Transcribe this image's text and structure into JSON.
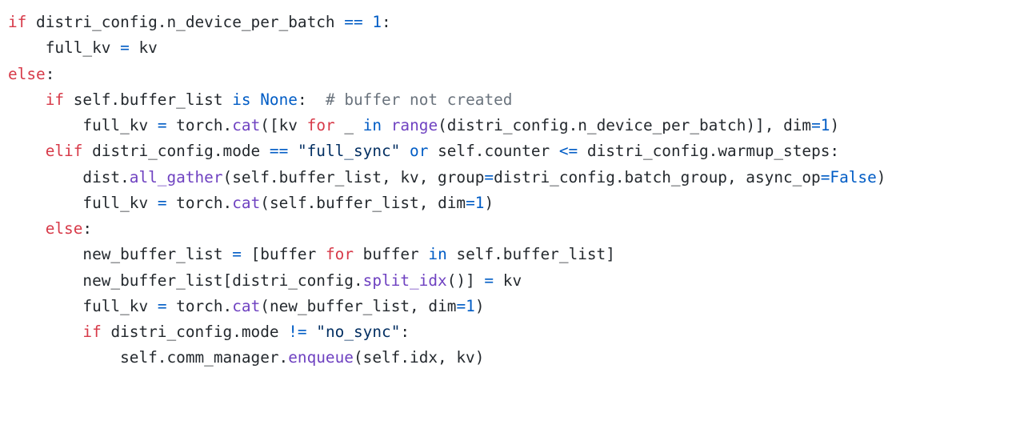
{
  "code": {
    "lines": [
      {
        "indent": 0,
        "tokens": [
          {
            "t": "if",
            "c": "kw"
          },
          {
            "t": " distri_config.n_device_per_batch ",
            "c": ""
          },
          {
            "t": "==",
            "c": "op"
          },
          {
            "t": " ",
            "c": ""
          },
          {
            "t": "1",
            "c": "num"
          },
          {
            "t": ":",
            "c": ""
          }
        ]
      },
      {
        "indent": 1,
        "tokens": [
          {
            "t": "full_kv ",
            "c": ""
          },
          {
            "t": "=",
            "c": "op"
          },
          {
            "t": " kv",
            "c": ""
          }
        ]
      },
      {
        "indent": 0,
        "tokens": [
          {
            "t": "else",
            "c": "kw"
          },
          {
            "t": ":",
            "c": ""
          }
        ]
      },
      {
        "indent": 1,
        "tokens": [
          {
            "t": "if",
            "c": "kw"
          },
          {
            "t": " self.buffer_list ",
            "c": ""
          },
          {
            "t": "is",
            "c": "op"
          },
          {
            "t": " ",
            "c": ""
          },
          {
            "t": "None",
            "c": "num"
          },
          {
            "t": ":  ",
            "c": ""
          },
          {
            "t": "# buffer not created",
            "c": "com"
          }
        ]
      },
      {
        "indent": 2,
        "tokens": [
          {
            "t": "full_kv ",
            "c": ""
          },
          {
            "t": "=",
            "c": "op"
          },
          {
            "t": " torch.",
            "c": ""
          },
          {
            "t": "cat",
            "c": "fn"
          },
          {
            "t": "([kv ",
            "c": ""
          },
          {
            "t": "for",
            "c": "kw"
          },
          {
            "t": " _ ",
            "c": ""
          },
          {
            "t": "in",
            "c": "op"
          },
          {
            "t": " ",
            "c": ""
          },
          {
            "t": "range",
            "c": "fn"
          },
          {
            "t": "(distri_config.n_device_per_batch)], dim",
            "c": ""
          },
          {
            "t": "=",
            "c": "op"
          },
          {
            "t": "1",
            "c": "num"
          },
          {
            "t": ")",
            "c": ""
          }
        ]
      },
      {
        "indent": 1,
        "tokens": [
          {
            "t": "elif",
            "c": "kw"
          },
          {
            "t": " distri_config.mode ",
            "c": ""
          },
          {
            "t": "==",
            "c": "op"
          },
          {
            "t": " ",
            "c": ""
          },
          {
            "t": "\"full_sync\"",
            "c": "str"
          },
          {
            "t": " ",
            "c": ""
          },
          {
            "t": "or",
            "c": "op"
          },
          {
            "t": " self.counter ",
            "c": ""
          },
          {
            "t": "<=",
            "c": "op"
          },
          {
            "t": " distri_config.warmup_steps:",
            "c": ""
          }
        ]
      },
      {
        "indent": 2,
        "tokens": [
          {
            "t": "dist.",
            "c": ""
          },
          {
            "t": "all_gather",
            "c": "fn"
          },
          {
            "t": "(self.buffer_list, kv, group",
            "c": ""
          },
          {
            "t": "=",
            "c": "op"
          },
          {
            "t": "distri_config.batch_group, async_op",
            "c": ""
          },
          {
            "t": "=",
            "c": "op"
          },
          {
            "t": "False",
            "c": "num"
          },
          {
            "t": ")",
            "c": ""
          }
        ]
      },
      {
        "indent": 2,
        "tokens": [
          {
            "t": "full_kv ",
            "c": ""
          },
          {
            "t": "=",
            "c": "op"
          },
          {
            "t": " torch.",
            "c": ""
          },
          {
            "t": "cat",
            "c": "fn"
          },
          {
            "t": "(self.buffer_list, dim",
            "c": ""
          },
          {
            "t": "=",
            "c": "op"
          },
          {
            "t": "1",
            "c": "num"
          },
          {
            "t": ")",
            "c": ""
          }
        ]
      },
      {
        "indent": 1,
        "tokens": [
          {
            "t": "else",
            "c": "kw"
          },
          {
            "t": ":",
            "c": ""
          }
        ]
      },
      {
        "indent": 2,
        "tokens": [
          {
            "t": "new_buffer_list ",
            "c": ""
          },
          {
            "t": "=",
            "c": "op"
          },
          {
            "t": " [buffer ",
            "c": ""
          },
          {
            "t": "for",
            "c": "kw"
          },
          {
            "t": " buffer ",
            "c": ""
          },
          {
            "t": "in",
            "c": "op"
          },
          {
            "t": " self.buffer_list]",
            "c": ""
          }
        ]
      },
      {
        "indent": 2,
        "tokens": [
          {
            "t": "new_buffer_list[distri_config.",
            "c": ""
          },
          {
            "t": "split_idx",
            "c": "fn"
          },
          {
            "t": "()] ",
            "c": ""
          },
          {
            "t": "=",
            "c": "op"
          },
          {
            "t": " kv",
            "c": ""
          }
        ]
      },
      {
        "indent": 2,
        "tokens": [
          {
            "t": "full_kv ",
            "c": ""
          },
          {
            "t": "=",
            "c": "op"
          },
          {
            "t": " torch.",
            "c": ""
          },
          {
            "t": "cat",
            "c": "fn"
          },
          {
            "t": "(new_buffer_list, dim",
            "c": ""
          },
          {
            "t": "=",
            "c": "op"
          },
          {
            "t": "1",
            "c": "num"
          },
          {
            "t": ")",
            "c": ""
          }
        ]
      },
      {
        "indent": 2,
        "tokens": [
          {
            "t": "if",
            "c": "kw"
          },
          {
            "t": " distri_config.mode ",
            "c": ""
          },
          {
            "t": "!=",
            "c": "op"
          },
          {
            "t": " ",
            "c": ""
          },
          {
            "t": "\"no_sync\"",
            "c": "str"
          },
          {
            "t": ":",
            "c": ""
          }
        ]
      },
      {
        "indent": 3,
        "tokens": [
          {
            "t": "self.comm_manager.",
            "c": ""
          },
          {
            "t": "enqueue",
            "c": "fn"
          },
          {
            "t": "(self.idx, kv)",
            "c": ""
          }
        ]
      }
    ]
  }
}
